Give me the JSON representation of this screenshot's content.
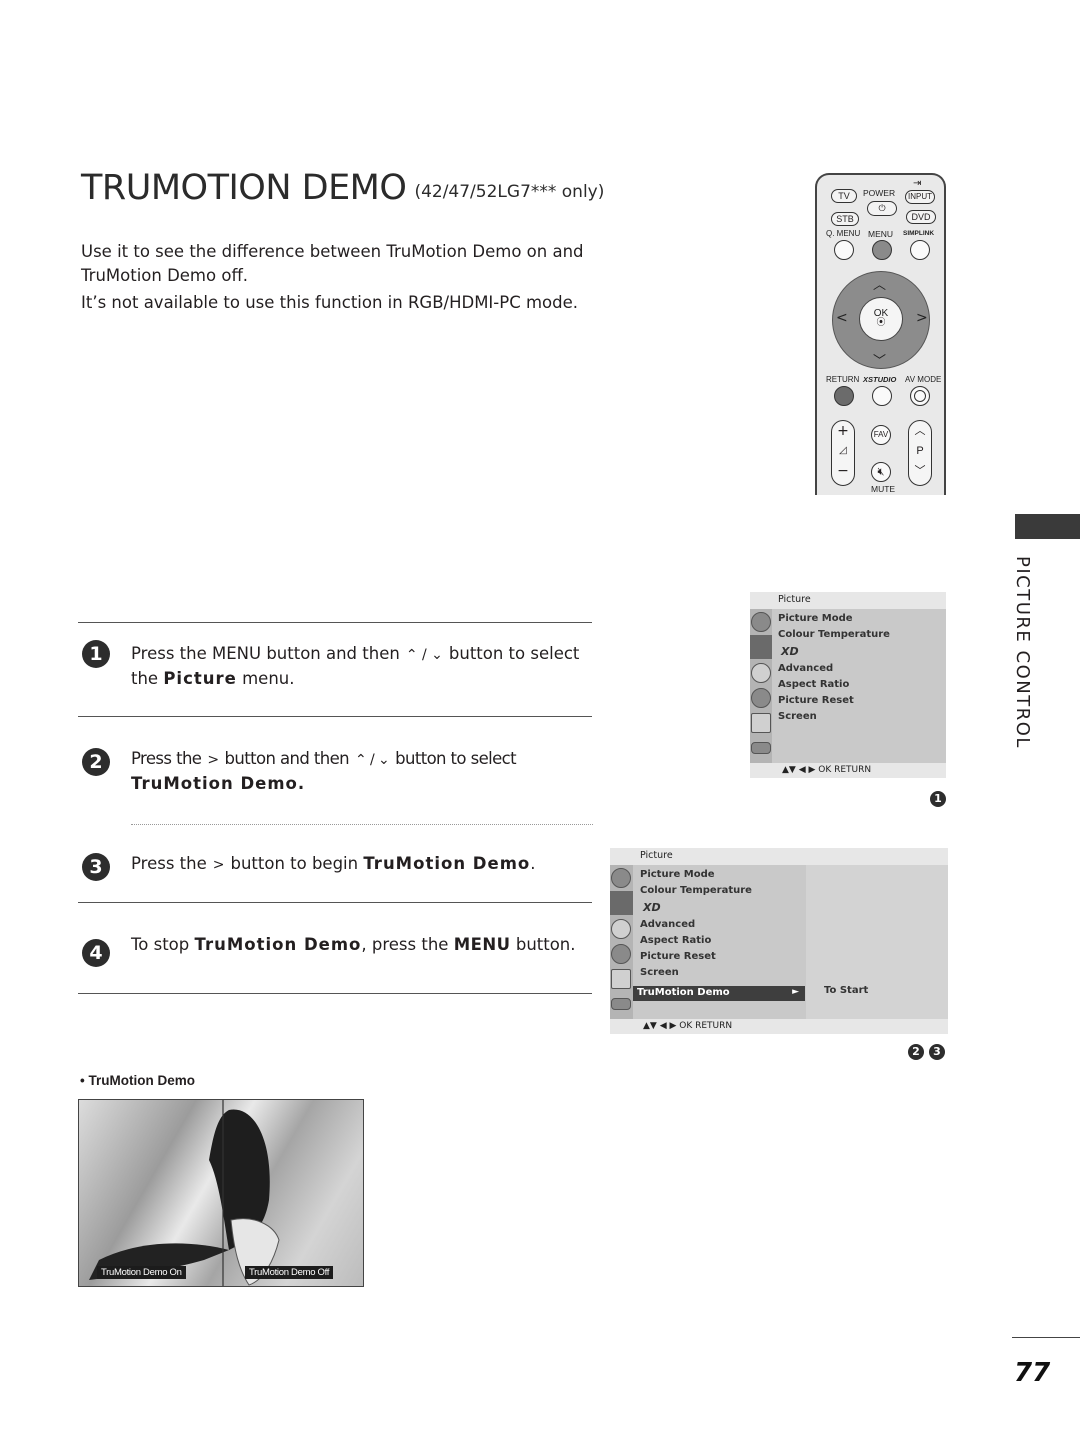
{
  "header": {
    "title": "TRUMOTION DEMO",
    "title_suffix": "(42/47/52LG7*** only)",
    "intro_line1": "Use it to see the difference between TruMotion Demo on and",
    "intro_line2": "TruMotion Demo off.",
    "intro_line3": "It’s not available to use this function in RGB/HDMI-PC mode."
  },
  "remote": {
    "tv": "TV",
    "power": "POWER",
    "input": "INPUT",
    "stb": "STB",
    "dvd": "DVD",
    "qmenu": "Q. MENU",
    "menu": "MENU",
    "simplink": "SIMPLINK",
    "ok": "OK",
    "return": "RETURN",
    "xstudio": "XSTUDIO",
    "avmode": "AV MODE",
    "fav": "FAV",
    "p": "P",
    "mute": "MUTE",
    "vol_up": "+",
    "vol_down": "−",
    "up": "^",
    "down": "v",
    "left": "<",
    "right": ">"
  },
  "steps": [
    {
      "num": "1",
      "pre": "Press the MENU button and then",
      "arrows": "⌃ / ⌄",
      "post": "button to select",
      "line2_pre": "the",
      "bold": "Picture",
      "line2_post": "menu."
    },
    {
      "num": "2",
      "pre": "Press the",
      "arrow1": ">",
      "mid": "button and then",
      "arrows": "⌃ / ⌄",
      "post": "button to select",
      "bold": "TruMotion Demo."
    },
    {
      "num": "3",
      "pre": "Press the",
      "arrow1": ">",
      "mid": "button to begin",
      "bold": "TruMotion Demo",
      "post": "."
    },
    {
      "num": "4",
      "pre": "To stop",
      "bold": "TruMotion Demo",
      "mid": ", press the",
      "bold2": "MENU",
      "post": "button."
    }
  ],
  "menu1": {
    "header": "Picture",
    "items": [
      "Picture Mode",
      "Colour Temperature",
      "XD",
      "Advanced",
      "Aspect Ratio",
      "Picture Reset",
      "Screen"
    ],
    "footer": "▲▼  ◀ ▶  OK  RETURN",
    "badge": "1"
  },
  "menu2": {
    "header": "Picture",
    "items": [
      "Picture Mode",
      "Colour Temperature",
      "XD",
      "Advanced",
      "Aspect Ratio",
      "Picture Reset",
      "Screen"
    ],
    "selected": "TruMotion Demo",
    "selected_arrow": "►",
    "submenu_value": "To Start",
    "footer": "▲▼  ◀ ▶  OK  RETURN",
    "badges": [
      "2",
      "3"
    ]
  },
  "demo": {
    "caption": "• TruMotion Demo",
    "label_on": "TruMotion Demo On",
    "label_off": "TruMotion Demo Off"
  },
  "sidebar": {
    "section": "PICTURE CONTROL"
  },
  "page": {
    "number": "77"
  }
}
